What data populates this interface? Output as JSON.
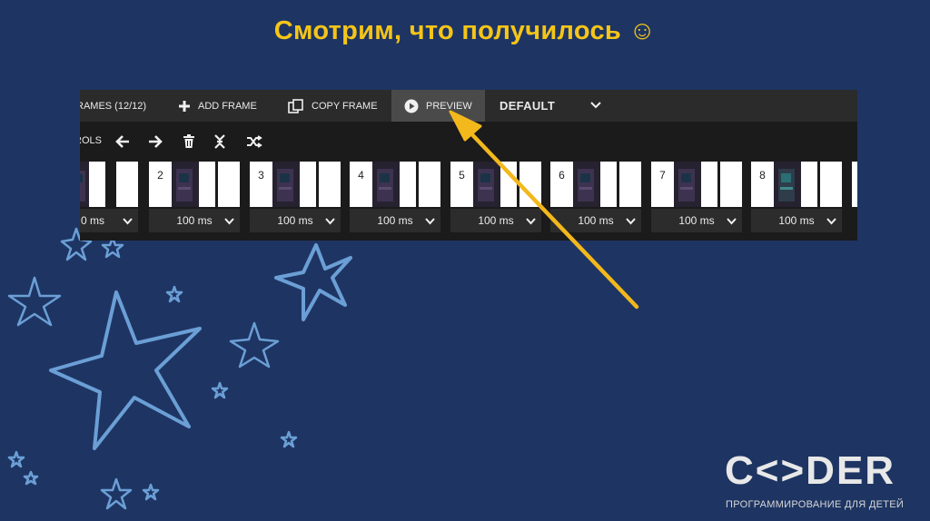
{
  "slide": {
    "title": "Смотрим, что получилось ☺"
  },
  "toolbar": {
    "frames_label": "RAMES (12/12)",
    "add_frame_label": "ADD FRAME",
    "copy_frame_label": "COPY FRAME",
    "preview_label": "PREVIEW",
    "default_label": "DEFAULT",
    "icons": [
      "plus-icon",
      "copy-icon",
      "play-circle-icon",
      "chevron-down-icon"
    ]
  },
  "controls": {
    "label": "ROLS",
    "icons": [
      "arrow-left-icon",
      "arrow-right-icon",
      "trash-icon",
      "collapse-icon",
      "shuffle-icon"
    ]
  },
  "frames": [
    {
      "number": "",
      "duration": "0 ms"
    },
    {
      "number": "2",
      "duration": "100 ms"
    },
    {
      "number": "3",
      "duration": "100 ms"
    },
    {
      "number": "4",
      "duration": "100 ms"
    },
    {
      "number": "5",
      "duration": "100 ms"
    },
    {
      "number": "6",
      "duration": "100 ms"
    },
    {
      "number": "7",
      "duration": "100 ms"
    },
    {
      "number": "8",
      "duration": "100 ms"
    }
  ],
  "logo": {
    "name": "C<>DER",
    "tagline": "ПРОГРАММИРОВАНИЕ ДЛЯ ДЕТЕЙ"
  },
  "colors": {
    "background": "#1e3563",
    "title": "#f5c518",
    "arrow": "#f2b81c",
    "stars": "#6b9fd6"
  }
}
